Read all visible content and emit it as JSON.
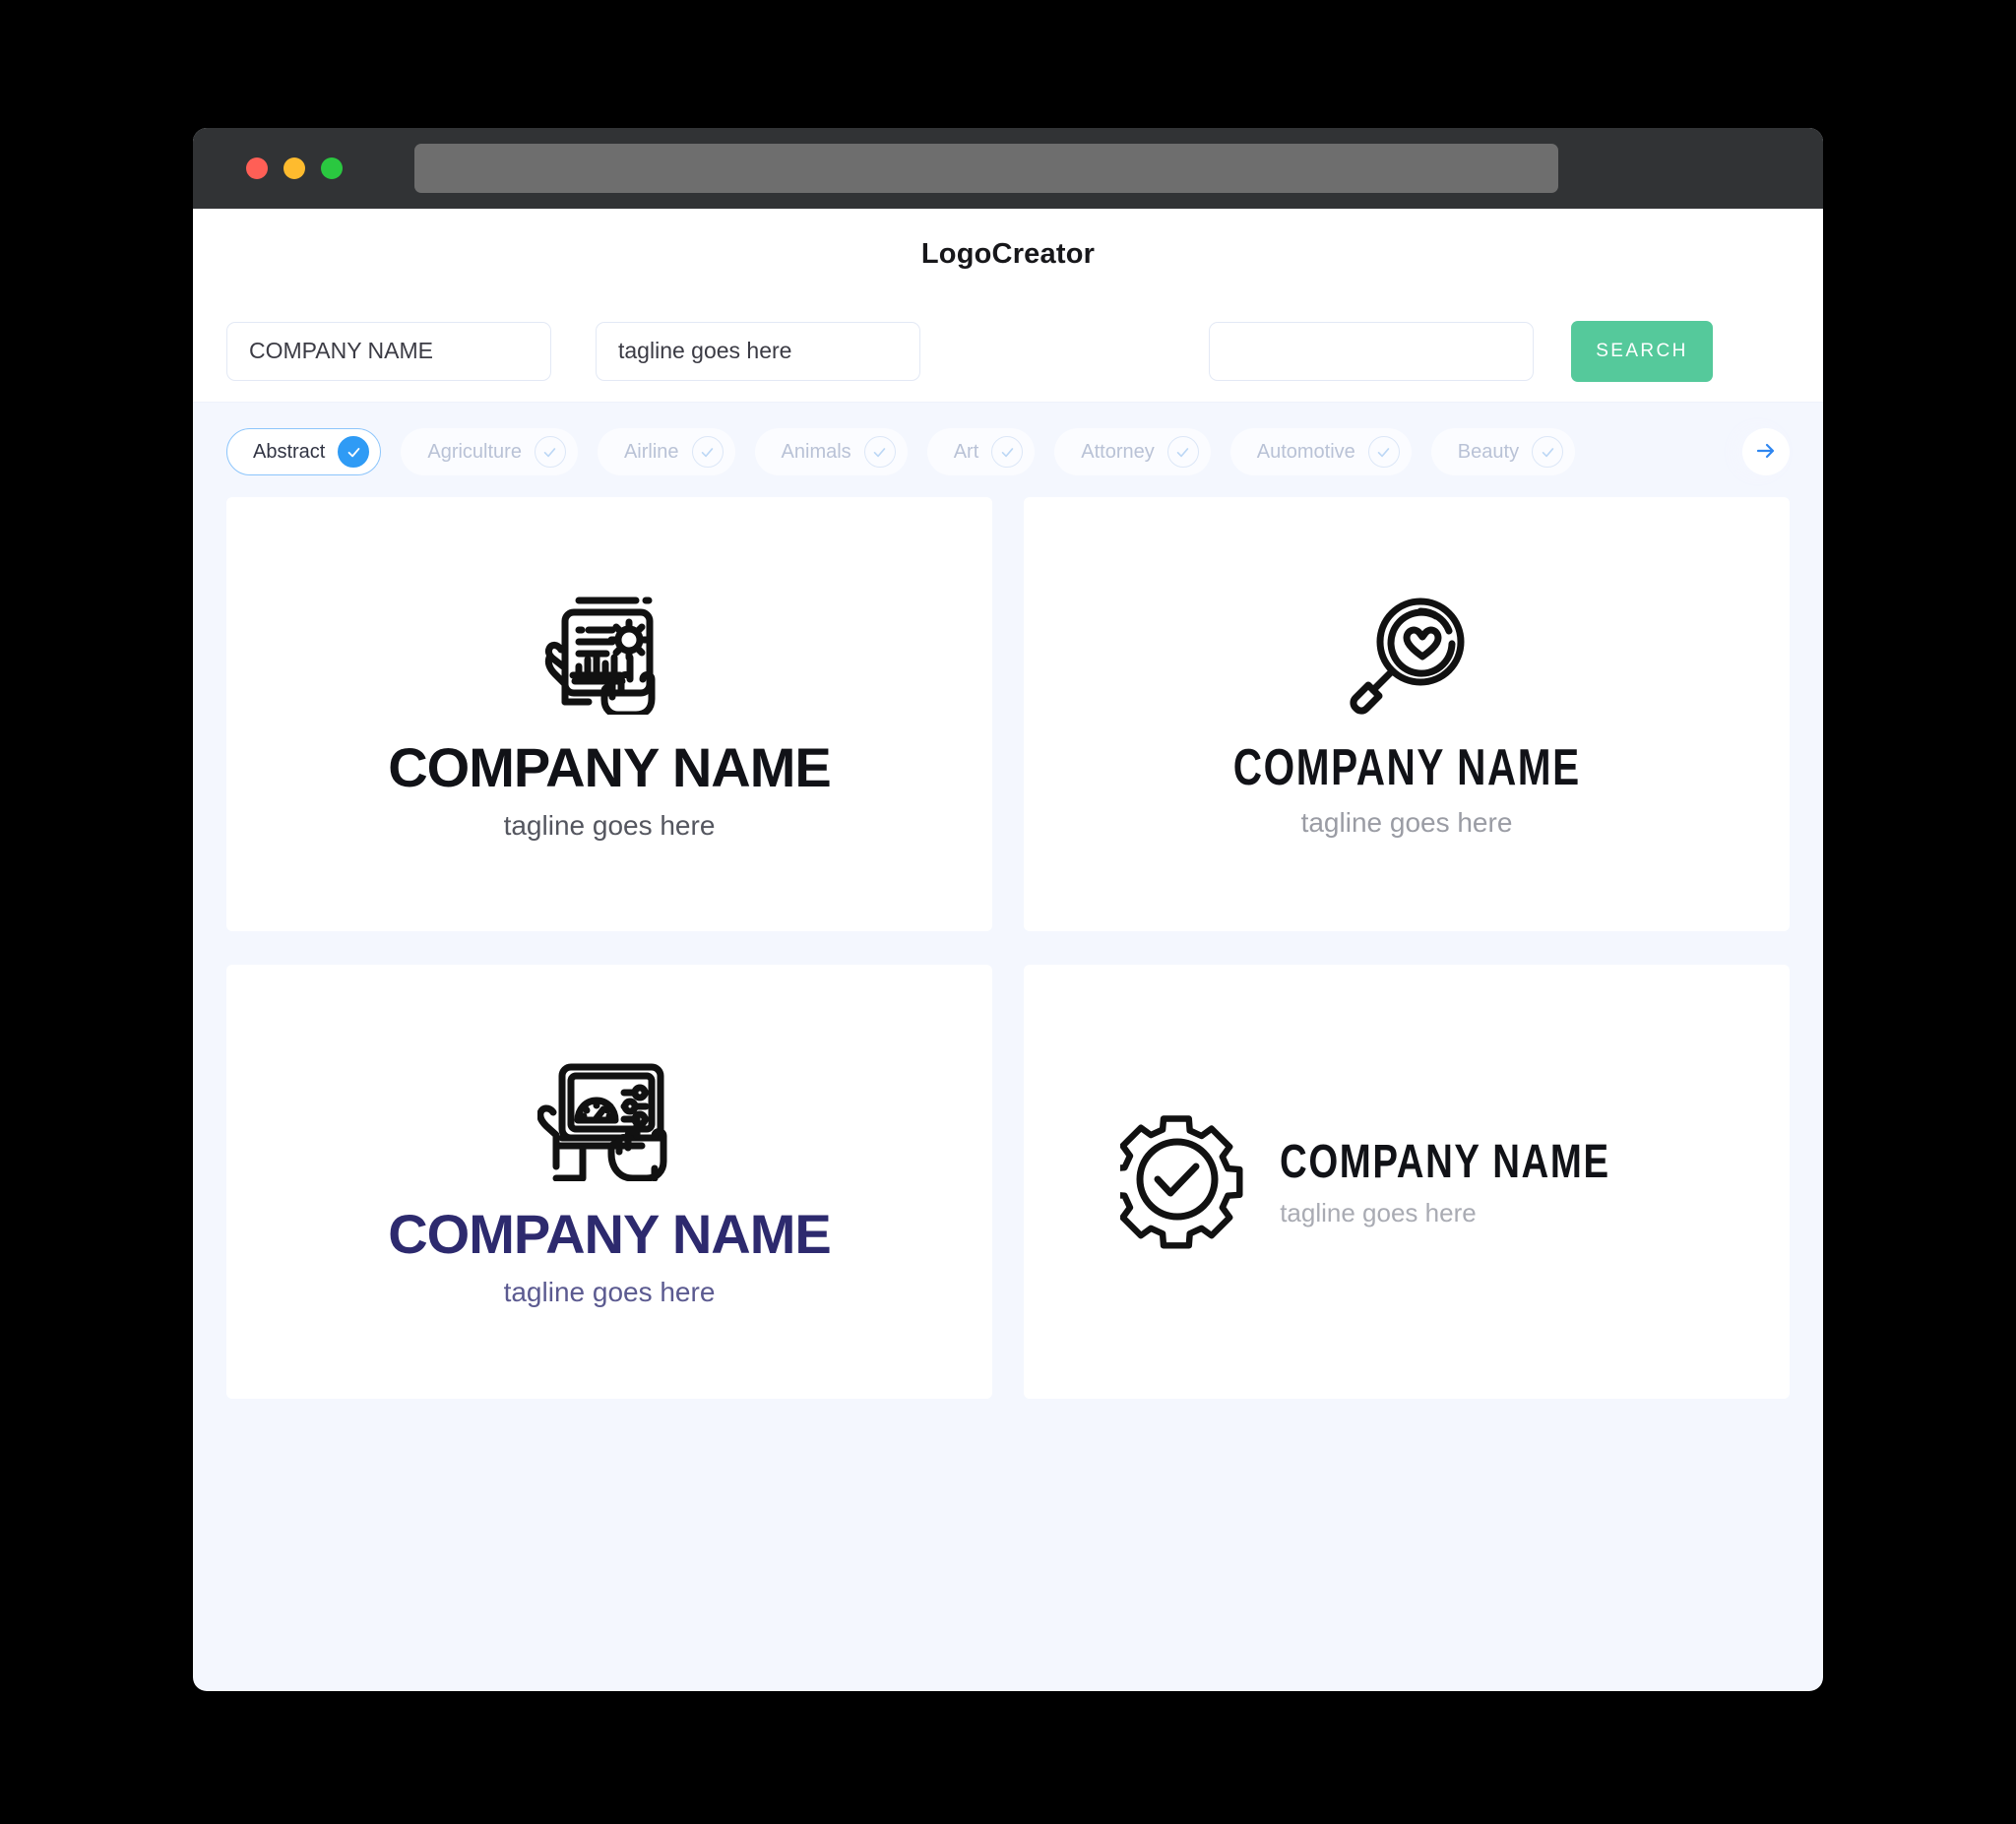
{
  "browser": {
    "traffic_lights": [
      "close",
      "minimize",
      "maximize"
    ],
    "url_value": ""
  },
  "header": {
    "brand": "LogoCreator"
  },
  "search": {
    "company_name_value": "COMPANY NAME",
    "company_name_placeholder": "COMPANY NAME",
    "tagline_value": "tagline goes here",
    "tagline_placeholder": "tagline goes here",
    "extra_value": "",
    "extra_placeholder": "",
    "button_label": "SEARCH",
    "button_color": "#55c99b"
  },
  "categories": {
    "accent_color": "#2f9bf5",
    "next_icon": "arrow-right-icon",
    "items": [
      {
        "label": "Abstract",
        "selected": true
      },
      {
        "label": "Agriculture",
        "selected": false
      },
      {
        "label": "Airline",
        "selected": false
      },
      {
        "label": "Animals",
        "selected": false
      },
      {
        "label": "Art",
        "selected": false
      },
      {
        "label": "Attorney",
        "selected": false
      },
      {
        "label": "Automotive",
        "selected": false
      },
      {
        "label": "Beauty",
        "selected": false
      }
    ]
  },
  "results": [
    {
      "icon": "tablet-gear-chart-hand-icon",
      "name": "COMPANY NAME",
      "tagline": "tagline goes here",
      "name_color": "#111217",
      "tagline_color": "#54565f",
      "layout": "stacked"
    },
    {
      "icon": "magnifier-check-icon",
      "name": "COMPANY NAME",
      "tagline": "tagline goes here",
      "name_color": "#111217",
      "tagline_color": "#9a9ca4",
      "layout": "stacked"
    },
    {
      "icon": "tablet-dashboard-hands-icon",
      "name": "COMPANY NAME",
      "tagline": "tagline goes here",
      "name_color": "#2d2a6e",
      "tagline_color": "#5b5a90",
      "layout": "stacked"
    },
    {
      "icon": "gear-check-icon",
      "name": "COMPANY NAME",
      "tagline": "tagline goes here",
      "name_color": "#111217",
      "tagline_color": "#a9abb3",
      "layout": "horizontal"
    }
  ]
}
